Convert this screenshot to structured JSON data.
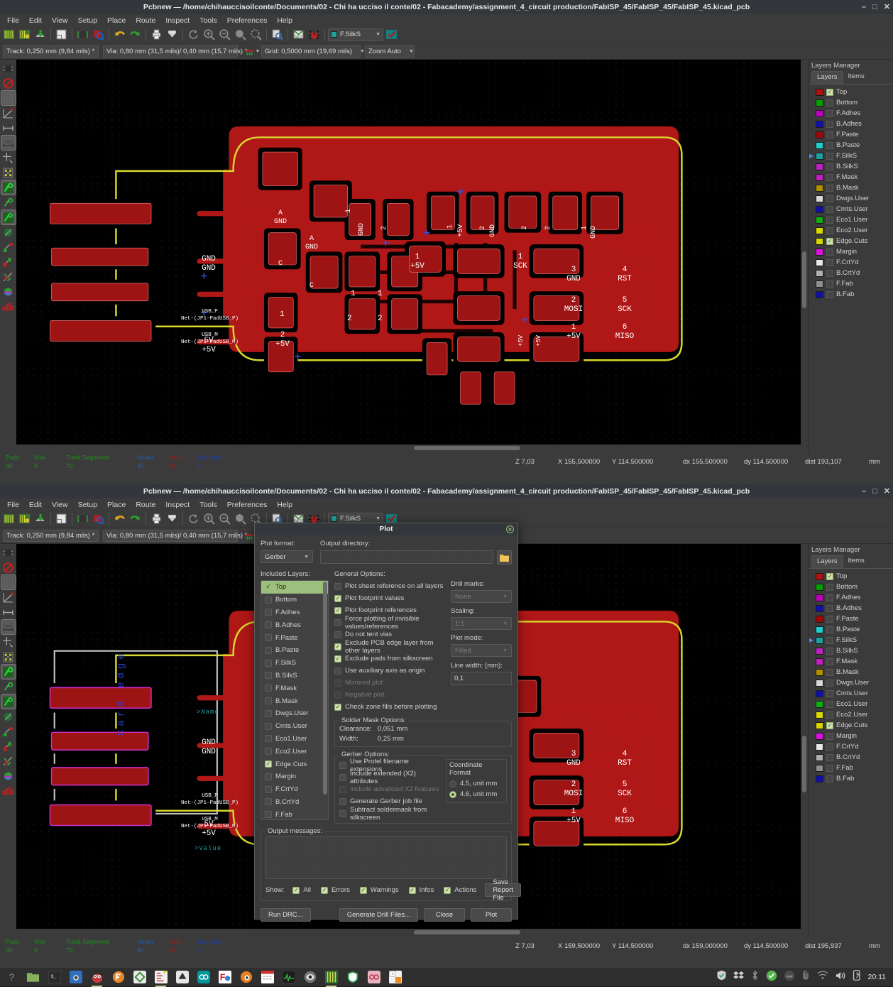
{
  "app": {
    "title": "Pcbnew — /home/chihauccisoilconte/Documents/02 - Chi ha ucciso il conte/02 - Fabacademy/assignment_4_circuit production/FabISP_45/FabISP_45/FabISP_45.kicad_pcb",
    "min_label": "–",
    "max_label": "□",
    "close_label": "✕"
  },
  "menu": [
    "File",
    "Edit",
    "View",
    "Setup",
    "Place",
    "Route",
    "Inspect",
    "Tools",
    "Preferences",
    "Help"
  ],
  "toolbar2": {
    "track": "Track: 0,250 mm (9,84 mils) *",
    "via": "Via: 0,80 mm (31,5 mils)/ 0,40 mm (15,7 mils) *",
    "grid": "Grid: 0,5000 mm (19,69 mils)",
    "zoom": "Zoom Auto",
    "active_layer": "F.SilkS",
    "active_layer_color": "#20a0a0"
  },
  "layers_manager": {
    "title": "Layers Manager",
    "tabs": [
      "Layers",
      "Items"
    ],
    "selected_tab": "Layers",
    "rows": [
      {
        "name": "Top",
        "color": "#b31010",
        "visible": true,
        "active": false
      },
      {
        "name": "Bottom",
        "color": "#00a000",
        "visible": false,
        "active": false
      },
      {
        "name": "F.Adhes",
        "color": "#c000c0",
        "visible": false,
        "active": false
      },
      {
        "name": "B.Adhes",
        "color": "#1010b0",
        "visible": false,
        "active": false
      },
      {
        "name": "F.Paste",
        "color": "#a00808",
        "visible": false,
        "active": false
      },
      {
        "name": "B.Paste",
        "color": "#20d0d0",
        "visible": false,
        "active": false
      },
      {
        "name": "F.SilkS",
        "color": "#20a0a0",
        "visible": false,
        "active": true
      },
      {
        "name": "B.SilkS",
        "color": "#c020c0",
        "visible": false,
        "active": false
      },
      {
        "name": "F.Mask",
        "color": "#c020c0",
        "visible": false,
        "active": false
      },
      {
        "name": "B.Mask",
        "color": "#b09000",
        "visible": false,
        "active": false
      },
      {
        "name": "Dwgs.User",
        "color": "#d8d8d8",
        "visible": false,
        "active": false
      },
      {
        "name": "Cmts.User",
        "color": "#1010a8",
        "visible": false,
        "active": false
      },
      {
        "name": "Eco1.User",
        "color": "#10b010",
        "visible": false,
        "active": false
      },
      {
        "name": "Eco2.User",
        "color": "#d8d800",
        "visible": false,
        "active": false
      },
      {
        "name": "Edge.Cuts",
        "color": "#d8d800",
        "visible": true,
        "active": false
      },
      {
        "name": "Margin",
        "color": "#e010e0",
        "visible": false,
        "active": false
      },
      {
        "name": "F.CrtYd",
        "color": "#e8e8e8",
        "visible": false,
        "active": false
      },
      {
        "name": "B.CrtYd",
        "color": "#b0b0b0",
        "visible": false,
        "active": false
      },
      {
        "name": "F.Fab",
        "color": "#909090",
        "visible": false,
        "active": false
      },
      {
        "name": "B.Fab",
        "color": "#1010a8",
        "visible": false,
        "active": false
      }
    ]
  },
  "status": {
    "headers": [
      "Pads",
      "Vias",
      "Track Segments",
      "Nodes",
      "Nets",
      "Unrouted"
    ],
    "values": [
      "40",
      "0",
      "70",
      "40",
      "13",
      "0"
    ],
    "header_colors": [
      "#1f8f1f",
      "#1f8f1f",
      "#1f8f1f",
      "#1f5fb0",
      "#a02020",
      "#1f3fc0"
    ],
    "win1": {
      "z": "Z 7,03",
      "x": "X 155,500000",
      "y": "Y 114,500000",
      "dx": "dx 155,500000",
      "dy": "dy 114,500000",
      "dist": "dist 193,107",
      "units": "mm"
    },
    "win2": {
      "z": "Z 7,03",
      "x": "X 159,500000",
      "y": "Y 114,500000",
      "dx": "dx 159,000000",
      "dy": "dy 114,500000",
      "dist": "dist 195,937",
      "units": "mm"
    }
  },
  "pcb": {
    "pads_left": [
      {
        "l1": "GND",
        "l2": "GND"
      },
      {
        "l1": "USB_P",
        "l2": "Net-(JP1-PadUSB_P)"
      },
      {
        "l1": "USB_M",
        "l2": "Net-(JP1-PadUSB_M)"
      },
      {
        "l1": "5V",
        "l2": "+5V"
      }
    ],
    "pads_right": [
      {
        "l1": "3",
        "l2": "GND"
      },
      {
        "l1": "4",
        "l2": "RST"
      },
      {
        "l1": "2",
        "l2": "MOSI"
      },
      {
        "l1": "5",
        "l2": "SCK"
      },
      {
        "l1": "1",
        "l2": "+5V"
      },
      {
        "l1": "6",
        "l2": "MISO"
      }
    ],
    "pads_misc": [
      {
        "l1": "A",
        "l2": "GND"
      },
      {
        "l1": "A",
        "l2": "GND"
      },
      {
        "l1": "C",
        "l2": ""
      },
      {
        "l1": "C",
        "l2": ""
      },
      {
        "l1": "1",
        "l2": "SCK"
      },
      {
        "l1": "1",
        "l2": "+5V"
      },
      {
        "l1": "2",
        "l2": "+5V"
      },
      {
        "l1": "2",
        "l2": "GND"
      },
      {
        "l1": "1",
        "l2": "GND"
      }
    ],
    "silk_name": ">Name",
    "silk_value": ">Value",
    "silk_card_edge": "Card edge"
  },
  "plot_dialog": {
    "title": "Plot",
    "close": "✕",
    "plot_format_label": "Plot format:",
    "plot_format_value": "Gerber",
    "output_dir_label": "Output directory:",
    "output_dir_value": "",
    "browse_icon": "folder-icon",
    "included_layers_label": "Included Layers:",
    "layers": [
      {
        "name": "Top",
        "checked": true,
        "selected": true
      },
      {
        "name": "Bottom",
        "checked": false,
        "selected": false
      },
      {
        "name": "F.Adhes",
        "checked": false,
        "selected": false
      },
      {
        "name": "B.Adhes",
        "checked": false,
        "selected": false
      },
      {
        "name": "F.Paste",
        "checked": false,
        "selected": false
      },
      {
        "name": "B.Paste",
        "checked": false,
        "selected": false
      },
      {
        "name": "F.SilkS",
        "checked": false,
        "selected": false
      },
      {
        "name": "B.SilkS",
        "checked": false,
        "selected": false
      },
      {
        "name": "F.Mask",
        "checked": false,
        "selected": false
      },
      {
        "name": "B.Mask",
        "checked": false,
        "selected": false
      },
      {
        "name": "Dwgs.User",
        "checked": false,
        "selected": false
      },
      {
        "name": "Cmts.User",
        "checked": false,
        "selected": false
      },
      {
        "name": "Eco1.User",
        "checked": false,
        "selected": false
      },
      {
        "name": "Eco2.User",
        "checked": false,
        "selected": false
      },
      {
        "name": "Edge.Cuts",
        "checked": true,
        "selected": false
      },
      {
        "name": "Margin",
        "checked": false,
        "selected": false
      },
      {
        "name": "F.CrtYd",
        "checked": false,
        "selected": false
      },
      {
        "name": "B.CrtYd",
        "checked": false,
        "selected": false
      },
      {
        "name": "F.Fab",
        "checked": false,
        "selected": false
      }
    ],
    "general_options_label": "General Options:",
    "general_options": [
      {
        "label": "Plot sheet reference on all layers",
        "checked": false,
        "disabled": false
      },
      {
        "label": "Plot footprint values",
        "checked": true,
        "disabled": false
      },
      {
        "label": "Plot footprint references",
        "checked": true,
        "disabled": false
      },
      {
        "label": "Force plotting of invisible values/references",
        "checked": false,
        "disabled": false
      },
      {
        "label": "Do not tent vias",
        "checked": false,
        "disabled": false
      },
      {
        "label": "Exclude PCB edge layer from other layers",
        "checked": true,
        "disabled": false
      },
      {
        "label": "Exclude pads from silkscreen",
        "checked": true,
        "disabled": false
      },
      {
        "label": "Use auxiliary axis as origin",
        "checked": false,
        "disabled": false
      },
      {
        "label": "Mirrored plot",
        "checked": false,
        "disabled": true
      },
      {
        "label": "Negative plot",
        "checked": false,
        "disabled": true
      },
      {
        "label": "Check zone fills before plotting",
        "checked": true,
        "disabled": false
      }
    ],
    "drill_marks_label": "Drill marks:",
    "drill_marks_value": "None",
    "scaling_label": "Scaling:",
    "scaling_value": "1:1",
    "plot_mode_label": "Plot mode:",
    "plot_mode_value": "Filled",
    "line_width_label": "Line width: (mm):",
    "line_width_value": "0,1",
    "solder_mask_label": "Solder Mask Options:",
    "clearance_label": "Clearance:",
    "clearance_value": "0,051 mm",
    "width_label": "Width:",
    "width_value": "0,25 mm",
    "gerber_options_label": "Gerber Options:",
    "gerber_options": [
      {
        "label": "Use Protel filename extensions",
        "checked": false,
        "disabled": false
      },
      {
        "label": "Include extended (X2) attributes",
        "checked": false,
        "disabled": false
      },
      {
        "label": "Include advanced X2 features",
        "checked": false,
        "disabled": true
      },
      {
        "label": "Generate Gerber job file",
        "checked": false,
        "disabled": false
      },
      {
        "label": "Subtract soldermask from silkscreen",
        "checked": false,
        "disabled": false
      }
    ],
    "coord_format_label": "Coordinate Format",
    "coord_options": [
      {
        "label": "4.5, unit mm",
        "selected": false
      },
      {
        "label": "4.6, unit mm",
        "selected": true
      }
    ],
    "output_messages_label": "Output messages:",
    "output_messages_value": "",
    "show_label": "Show:",
    "show_filters": [
      {
        "label": "All",
        "checked": true
      },
      {
        "label": "Errors",
        "checked": true
      },
      {
        "label": "Warnings",
        "checked": true
      },
      {
        "label": "Infos",
        "checked": true
      },
      {
        "label": "Actions",
        "checked": true
      }
    ],
    "save_report_label": "Save Report File",
    "run_drc_label": "Run DRC...",
    "generate_drill_label": "Generate Drill Files...",
    "close_label": "Close",
    "plot_label": "Plot"
  },
  "taskbar": {
    "clock": "20:11",
    "apps": [
      "help-icon",
      "files-icon",
      "terminal-icon",
      "camera-icon",
      "gimp-icon",
      "freecad-icon",
      "meshlab-icon",
      "kicad-eeschema-icon",
      "inkscape-icon",
      "arduino-icon",
      "fritzing-icon",
      "blender-icon",
      "calendar-icon",
      "monitor-icon",
      "eye-icon",
      "kicad-pcbnew-icon",
      "shield-icon",
      "glasses-icon",
      "calculator-icon"
    ],
    "tray": [
      "shield-icon",
      "dropbox-icon",
      "bluetooth-icon",
      "check-icon",
      "intel-icon",
      "clip-icon",
      "wifi-icon",
      "volume-icon",
      "battery-icon"
    ]
  }
}
